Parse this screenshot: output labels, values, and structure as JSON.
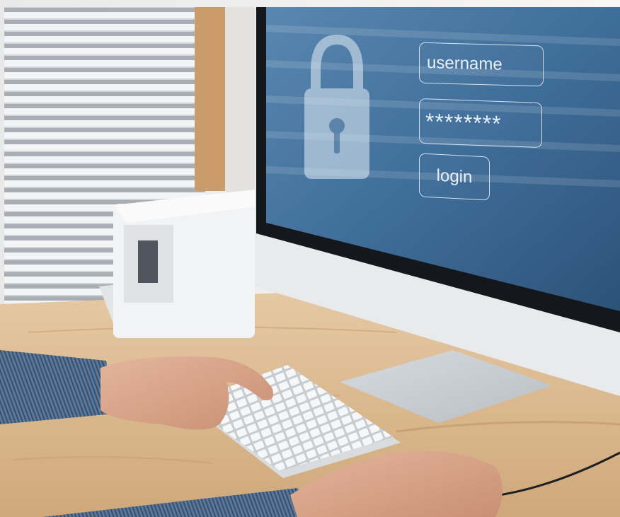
{
  "login_form": {
    "username_placeholder": "username",
    "password_mask": "********",
    "login_label": "login"
  },
  "colors": {
    "screen": "#3f6e9a",
    "desk": "#d8b88e",
    "monitor": "#e8eaec",
    "shirt": "#4d6889"
  },
  "icons": {
    "lock": "padlock-icon"
  }
}
